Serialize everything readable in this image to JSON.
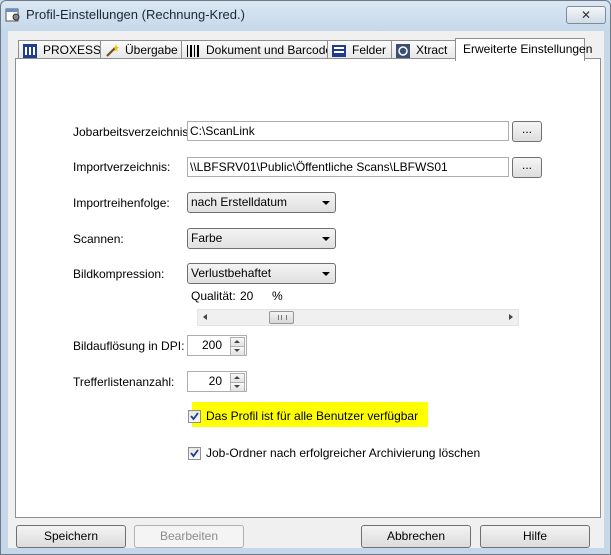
{
  "window": {
    "title": "Profil-Einstellungen (Rechnung-Kred.)",
    "close_label": "✕"
  },
  "tabs": [
    {
      "label": "PROXESS",
      "icon": "proxess-icon"
    },
    {
      "label": "Übergabe",
      "icon": "magic-wand-icon"
    },
    {
      "label": "Dokument und Barcode",
      "icon": "barcode-icon"
    },
    {
      "label": "Felder",
      "icon": "fields-icon"
    },
    {
      "label": "Xtract",
      "icon": "xtract-icon"
    },
    {
      "label": "Erweiterte Einstellungen",
      "active": true
    }
  ],
  "form": {
    "jobdir_label": "Jobarbeitsverzeichnis:",
    "jobdir_value": "C:\\ScanLink",
    "browse_label": "...",
    "importdir_label": "Importverzeichnis:",
    "importdir_value": "\\\\LBFSRV01\\Public\\Öffentliche Scans\\LBFWS01",
    "importorder_label": "Importreihenfolge:",
    "importorder_value": "nach Erstelldatum",
    "scan_label": "Scannen:",
    "scan_value": "Farbe",
    "compression_label": "Bildkompression:",
    "compression_value": "Verlustbehaftet",
    "quality_label": "Qualität:",
    "quality_value": "20",
    "quality_unit": "%",
    "dpi_label": "Bildauflösung in DPI:",
    "dpi_value": "200",
    "hits_label": "Trefferlistenanzahl:",
    "hits_value": "20",
    "check_all_users_label": "Das Profil ist für alle Benutzer verfügbar",
    "check_all_users_checked": true,
    "check_delete_label": "Job-Ordner nach erfolgreicher Archivierung löschen",
    "check_delete_checked": true
  },
  "buttons": {
    "save": "Speichern",
    "edit": "Bearbeiten",
    "cancel": "Abbrechen",
    "help": "Hilfe"
  },
  "colors": {
    "highlight": "#ffff00",
    "checkmark": "#1c3f94"
  }
}
